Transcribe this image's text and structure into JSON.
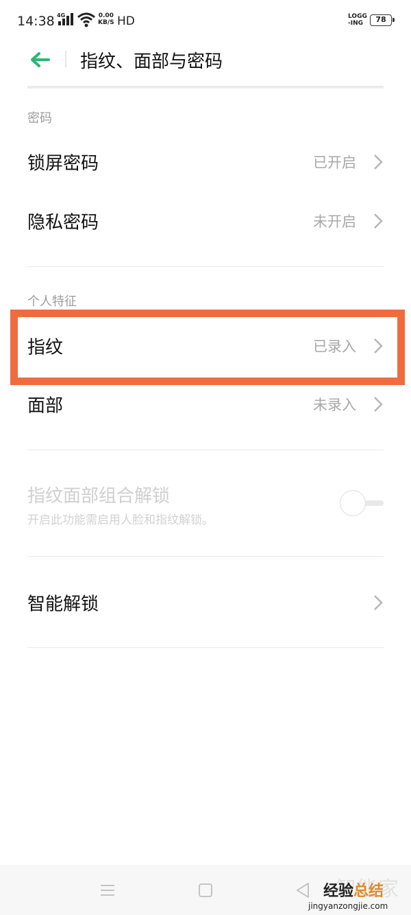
{
  "status_bar": {
    "time": "14:38",
    "network": "4G",
    "speed_value": "0.00",
    "speed_unit": "KB/S",
    "hd": "HD",
    "logging_line1": "LOGG",
    "logging_line2": "-ING",
    "battery": "78"
  },
  "header": {
    "title": "指纹、面部与密码",
    "back_icon": "arrow-left-icon",
    "accent_color": "#2bb673"
  },
  "sections": {
    "password": {
      "label": "密码",
      "items": [
        {
          "label": "锁屏密码",
          "value": "已开启"
        },
        {
          "label": "隐私密码",
          "value": "未开启"
        }
      ]
    },
    "biometrics": {
      "label": "个人特征",
      "items": [
        {
          "label": "指纹",
          "value": "已录入"
        },
        {
          "label": "面部",
          "value": "未录入"
        }
      ]
    },
    "combo_unlock": {
      "title": "指纹面部组合解锁",
      "subtitle": "开启此功能需启用人脸和指纹解锁。",
      "enabled": false
    },
    "smart_unlock": {
      "label": "智能解锁"
    }
  },
  "highlight_color": "#f06b3e",
  "navbar": {
    "menu_icon": "menu-icon",
    "home_icon": "home-square-icon",
    "back_icon": "back-triangle-icon"
  },
  "watermark": {
    "top": "智能家",
    "cn_main": "经验",
    "cn_accent": "总结",
    "url": "jingyanzongjie.com"
  }
}
